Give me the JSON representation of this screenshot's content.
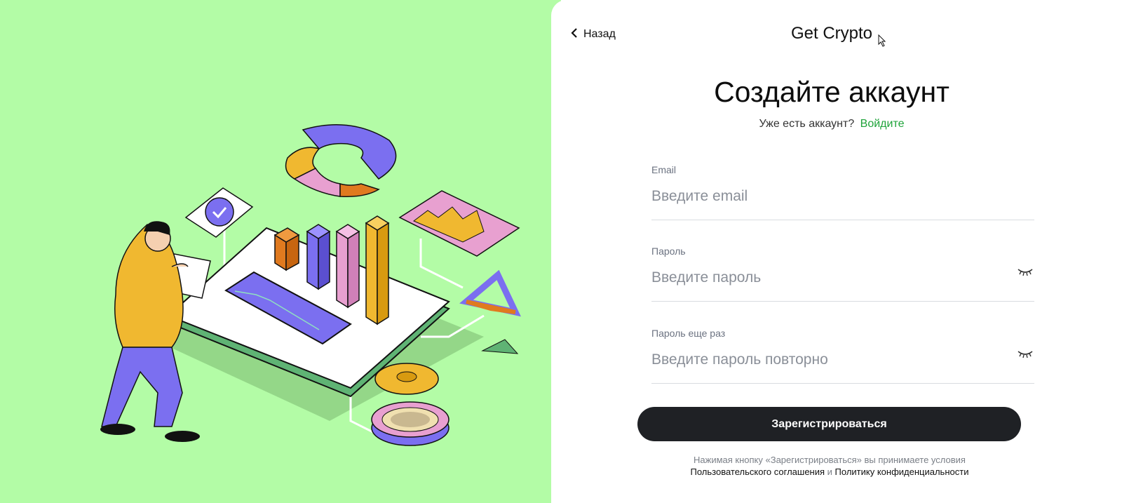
{
  "header": {
    "back_label": "Назад",
    "brand": "Get Crypto"
  },
  "form": {
    "title": "Создайте аккаунт",
    "have_account_text": "Уже есть аккаунт?",
    "login_link": "Войдите",
    "email": {
      "label": "Email",
      "placeholder": "Введите email",
      "value": ""
    },
    "password": {
      "label": "Пароль",
      "placeholder": "Введите пароль",
      "value": ""
    },
    "password_repeat": {
      "label": "Пароль еще раз",
      "placeholder": "Введите пароль повторно",
      "value": ""
    },
    "submit_label": "Зарегистрироваться",
    "terms_text": "Нажимая кнопку «Зарегистрироваться» вы принимаете условия",
    "terms_link_agreement": "Пользовательского соглашения",
    "terms_and": "и",
    "terms_link_privacy": "Политику конфиденциальности"
  },
  "colors": {
    "left_panel_bg": "#b3fca6",
    "accent_link": "#1ea339",
    "button_bg": "#1f2125"
  },
  "icons": {
    "back": "chevron-left-icon",
    "password_toggle": "eye-closed-icon",
    "cursor": "mouse-pointer-icon"
  }
}
